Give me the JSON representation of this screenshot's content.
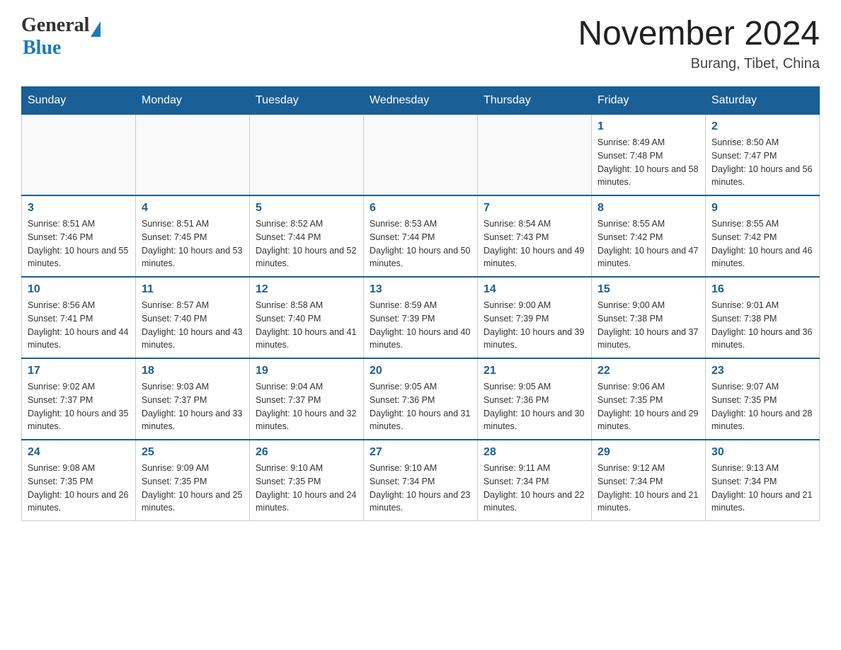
{
  "header": {
    "logo_general": "General",
    "logo_blue": "Blue",
    "month_year": "November 2024",
    "location": "Burang, Tibet, China"
  },
  "days_of_week": [
    "Sunday",
    "Monday",
    "Tuesday",
    "Wednesday",
    "Thursday",
    "Friday",
    "Saturday"
  ],
  "weeks": [
    [
      {
        "day": "",
        "info": ""
      },
      {
        "day": "",
        "info": ""
      },
      {
        "day": "",
        "info": ""
      },
      {
        "day": "",
        "info": ""
      },
      {
        "day": "",
        "info": ""
      },
      {
        "day": "1",
        "info": "Sunrise: 8:49 AM\nSunset: 7:48 PM\nDaylight: 10 hours and 58 minutes."
      },
      {
        "day": "2",
        "info": "Sunrise: 8:50 AM\nSunset: 7:47 PM\nDaylight: 10 hours and 56 minutes."
      }
    ],
    [
      {
        "day": "3",
        "info": "Sunrise: 8:51 AM\nSunset: 7:46 PM\nDaylight: 10 hours and 55 minutes."
      },
      {
        "day": "4",
        "info": "Sunrise: 8:51 AM\nSunset: 7:45 PM\nDaylight: 10 hours and 53 minutes."
      },
      {
        "day": "5",
        "info": "Sunrise: 8:52 AM\nSunset: 7:44 PM\nDaylight: 10 hours and 52 minutes."
      },
      {
        "day": "6",
        "info": "Sunrise: 8:53 AM\nSunset: 7:44 PM\nDaylight: 10 hours and 50 minutes."
      },
      {
        "day": "7",
        "info": "Sunrise: 8:54 AM\nSunset: 7:43 PM\nDaylight: 10 hours and 49 minutes."
      },
      {
        "day": "8",
        "info": "Sunrise: 8:55 AM\nSunset: 7:42 PM\nDaylight: 10 hours and 47 minutes."
      },
      {
        "day": "9",
        "info": "Sunrise: 8:55 AM\nSunset: 7:42 PM\nDaylight: 10 hours and 46 minutes."
      }
    ],
    [
      {
        "day": "10",
        "info": "Sunrise: 8:56 AM\nSunset: 7:41 PM\nDaylight: 10 hours and 44 minutes."
      },
      {
        "day": "11",
        "info": "Sunrise: 8:57 AM\nSunset: 7:40 PM\nDaylight: 10 hours and 43 minutes."
      },
      {
        "day": "12",
        "info": "Sunrise: 8:58 AM\nSunset: 7:40 PM\nDaylight: 10 hours and 41 minutes."
      },
      {
        "day": "13",
        "info": "Sunrise: 8:59 AM\nSunset: 7:39 PM\nDaylight: 10 hours and 40 minutes."
      },
      {
        "day": "14",
        "info": "Sunrise: 9:00 AM\nSunset: 7:39 PM\nDaylight: 10 hours and 39 minutes."
      },
      {
        "day": "15",
        "info": "Sunrise: 9:00 AM\nSunset: 7:38 PM\nDaylight: 10 hours and 37 minutes."
      },
      {
        "day": "16",
        "info": "Sunrise: 9:01 AM\nSunset: 7:38 PM\nDaylight: 10 hours and 36 minutes."
      }
    ],
    [
      {
        "day": "17",
        "info": "Sunrise: 9:02 AM\nSunset: 7:37 PM\nDaylight: 10 hours and 35 minutes."
      },
      {
        "day": "18",
        "info": "Sunrise: 9:03 AM\nSunset: 7:37 PM\nDaylight: 10 hours and 33 minutes."
      },
      {
        "day": "19",
        "info": "Sunrise: 9:04 AM\nSunset: 7:37 PM\nDaylight: 10 hours and 32 minutes."
      },
      {
        "day": "20",
        "info": "Sunrise: 9:05 AM\nSunset: 7:36 PM\nDaylight: 10 hours and 31 minutes."
      },
      {
        "day": "21",
        "info": "Sunrise: 9:05 AM\nSunset: 7:36 PM\nDaylight: 10 hours and 30 minutes."
      },
      {
        "day": "22",
        "info": "Sunrise: 9:06 AM\nSunset: 7:35 PM\nDaylight: 10 hours and 29 minutes."
      },
      {
        "day": "23",
        "info": "Sunrise: 9:07 AM\nSunset: 7:35 PM\nDaylight: 10 hours and 28 minutes."
      }
    ],
    [
      {
        "day": "24",
        "info": "Sunrise: 9:08 AM\nSunset: 7:35 PM\nDaylight: 10 hours and 26 minutes."
      },
      {
        "day": "25",
        "info": "Sunrise: 9:09 AM\nSunset: 7:35 PM\nDaylight: 10 hours and 25 minutes."
      },
      {
        "day": "26",
        "info": "Sunrise: 9:10 AM\nSunset: 7:35 PM\nDaylight: 10 hours and 24 minutes."
      },
      {
        "day": "27",
        "info": "Sunrise: 9:10 AM\nSunset: 7:34 PM\nDaylight: 10 hours and 23 minutes."
      },
      {
        "day": "28",
        "info": "Sunrise: 9:11 AM\nSunset: 7:34 PM\nDaylight: 10 hours and 22 minutes."
      },
      {
        "day": "29",
        "info": "Sunrise: 9:12 AM\nSunset: 7:34 PM\nDaylight: 10 hours and 21 minutes."
      },
      {
        "day": "30",
        "info": "Sunrise: 9:13 AM\nSunset: 7:34 PM\nDaylight: 10 hours and 21 minutes."
      }
    ]
  ]
}
